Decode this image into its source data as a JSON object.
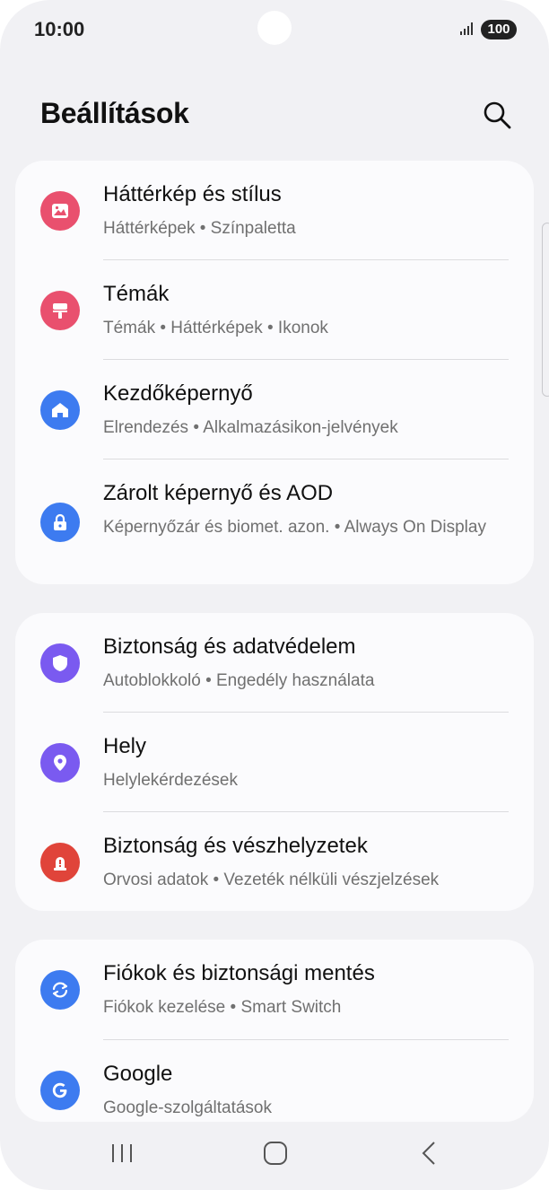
{
  "status_bar": {
    "time": "10:00",
    "battery": "100",
    "signal_icon": "signal-bars-icon"
  },
  "header": {
    "title": "Beállítások",
    "search_icon": "search-icon"
  },
  "groups": [
    {
      "items": [
        {
          "title": "Háttérkép és stílus",
          "subtitle": "Háttérképek  •  Színpaletta",
          "icon": "wallpaper-icon",
          "icon_color": "#e9506e"
        },
        {
          "title": "Témák",
          "subtitle": "Témák  •  Háttérképek  •  Ikonok",
          "icon": "paint-roller-icon",
          "icon_color": "#e9506e"
        },
        {
          "title": "Kezdőképernyő",
          "subtitle": "Elrendezés  •  Alkalmazásikon-jelvények",
          "icon": "home-icon",
          "icon_color": "#3d7bf0"
        },
        {
          "title": "Zárolt képernyő és AOD",
          "subtitle": "Képernyőzár és biomet. azon.  •  Always On Display",
          "icon": "lock-icon",
          "icon_color": "#3d7bf0"
        }
      ]
    },
    {
      "items": [
        {
          "title": "Biztonság és adatvédelem",
          "subtitle": "Autoblokkoló  •  Engedély használata",
          "icon": "shield-icon",
          "icon_color": "#7a5af0"
        },
        {
          "title": "Hely",
          "subtitle": "Helylekérdezések",
          "icon": "location-pin-icon",
          "icon_color": "#7a5af0"
        },
        {
          "title": "Biztonság és vészhelyzetek",
          "subtitle": "Orvosi adatok  •  Vezeték nélküli vészjelzések",
          "icon": "emergency-siren-icon",
          "icon_color": "#e0443a"
        }
      ]
    },
    {
      "items": [
        {
          "title": "Fiókok és biztonsági mentés",
          "subtitle": "Fiókok kezelése  •  Smart Switch",
          "icon": "sync-icon",
          "icon_color": "#3d7bf0"
        },
        {
          "title": "Google",
          "subtitle": "Google-szolgáltatások",
          "icon": "google-icon",
          "icon_color": "#3d7bf0"
        }
      ]
    }
  ],
  "nav_bar": {
    "recents_icon": "recents-icon",
    "home_icon": "home-button-icon",
    "back_icon": "back-icon"
  }
}
